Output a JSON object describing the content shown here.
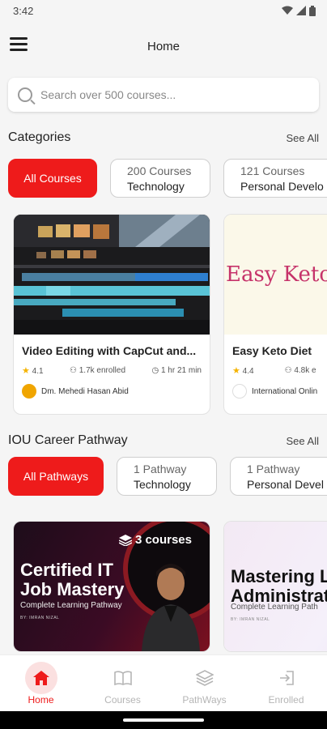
{
  "status_bar": {
    "time": "3:42"
  },
  "app_bar": {
    "title": "Home"
  },
  "search": {
    "placeholder": "Search over 500 courses..."
  },
  "categories": {
    "title": "Categories",
    "see_all": "See All",
    "chips": [
      {
        "label": "All Courses"
      },
      {
        "count": "200 Courses",
        "name": "Technology"
      },
      {
        "count": "121 Courses",
        "name": "Personal Develo"
      }
    ]
  },
  "courses": [
    {
      "title": "Video Editing with CapCut and...",
      "rating": "4.1",
      "enrolled": "1.7k enrolled",
      "duration": "1 hr 21 min",
      "author": "Dm. Mehedi Hasan Abid"
    },
    {
      "title": "Easy Keto Diet",
      "image_text": "Easy Keto",
      "rating": "4.4",
      "enrolled": "4.8k e",
      "author": "International Onlin"
    }
  ],
  "pathway": {
    "title": "IOU Career Pathway",
    "see_all": "See All",
    "chips": [
      {
        "label": "All Pathways"
      },
      {
        "count": "1 Pathway",
        "name": "Technology"
      },
      {
        "count": "1 Pathway",
        "name": "Personal Devel"
      }
    ],
    "cards": [
      {
        "badge": "3 courses",
        "title_line1": "Certified IT",
        "title_line2": "Job Mastery",
        "subtitle": "Complete Learning Pathway",
        "by": "BY: IMRAN NIZAL"
      },
      {
        "title_line1": "Mastering L",
        "title_line2": "Administrat",
        "subtitle": "Complete Learning Path",
        "by": "BY: IMRAN NIZAL"
      }
    ]
  },
  "bottom_nav": [
    {
      "label": "Home"
    },
    {
      "label": "Courses"
    },
    {
      "label": "PathWays"
    },
    {
      "label": "Enrolled"
    }
  ],
  "colors": {
    "accent": "#ee1b1b",
    "background": "#f5f5f5"
  }
}
